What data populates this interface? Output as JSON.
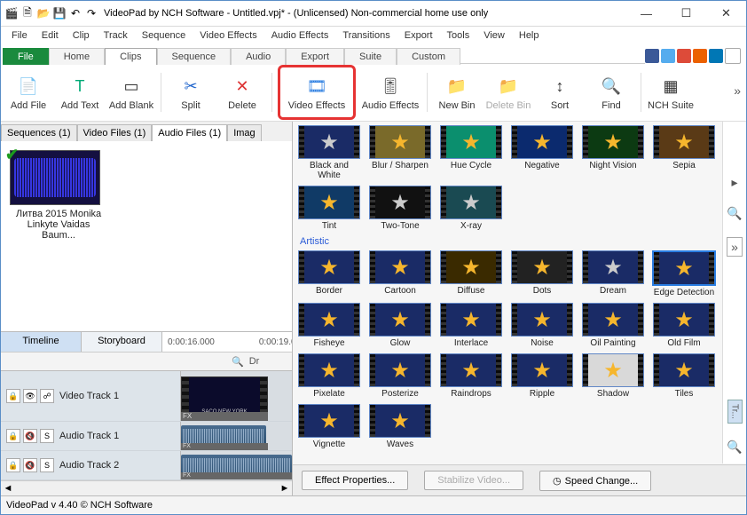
{
  "titlebar": {
    "title": "VideoPad by NCH Software - Untitled.vpj* - (Unlicensed) Non-commercial home use only"
  },
  "menubar": [
    "File",
    "Edit",
    "Clip",
    "Track",
    "Sequence",
    "Video Effects",
    "Audio Effects",
    "Transitions",
    "Export",
    "Tools",
    "View",
    "Help"
  ],
  "ribbon_tabs": [
    "File",
    "Home",
    "Clips",
    "Sequence",
    "Audio",
    "Export",
    "Suite",
    "Custom"
  ],
  "ribbon_active": "Clips",
  "toolbar": {
    "add_file": "Add File",
    "add_text": "Add Text",
    "add_blank": "Add Blank",
    "split": "Split",
    "delete": "Delete",
    "video_effects": "Video Effects",
    "audio_effects": "Audio Effects",
    "new_bin": "New Bin",
    "delete_bin": "Delete Bin",
    "sort": "Sort",
    "find": "Find",
    "nch_suite": "NCH Suite"
  },
  "file_tabs": [
    "Sequences (1)",
    "Video Files (1)",
    "Audio Files (1)",
    "Imag"
  ],
  "file_tabs_active": "Audio Files (1)",
  "clip": {
    "name": "Литва 2015 Monika Linkyte  Vaidas Baum..."
  },
  "timeline_tabs": {
    "timeline": "Timeline",
    "storyboard": "Storyboard"
  },
  "timecodes": [
    "0:00:16.000",
    "0:00:19.0"
  ],
  "tlopts": {
    "drop": "Dr"
  },
  "tracks": {
    "video1": "Video Track 1",
    "audio1": "Audio Track 1",
    "audio2": "Audio Track 2",
    "fx": "FX"
  },
  "fx": {
    "row1": [
      {
        "label": "Black and White",
        "cls": "graystar"
      },
      {
        "label": "Blur / Sharpen",
        "cls": "star",
        "bg": "#7a6a2a"
      },
      {
        "label": "Hue Cycle",
        "cls": "star",
        "bg": "#0b8f6e",
        "star": "#19e3b1"
      },
      {
        "label": "Negative",
        "cls": "star",
        "bg": "#0b2a6e",
        "star": "#1f62ff"
      },
      {
        "label": "Night Vision",
        "cls": "star",
        "bg": "#0c3a12",
        "star": "#68d66f"
      },
      {
        "label": "Sepia",
        "cls": "star",
        "bg": "#5a3a16",
        "star": "#c79a58"
      }
    ],
    "row2": [
      {
        "label": "Tint",
        "cls": "star",
        "bg": "#103a66",
        "star": "#63a6e8"
      },
      {
        "label": "Two-Tone",
        "cls": "graystar",
        "bg": "#111"
      },
      {
        "label": "X-ray",
        "cls": "graystar",
        "bg": "#1a4a52",
        "star": "#9fe"
      }
    ],
    "artistic_label": "Artistic",
    "artistic": [
      [
        {
          "label": "Border",
          "cls": "star"
        },
        {
          "label": "Cartoon",
          "cls": "star"
        },
        {
          "label": "Diffuse",
          "cls": "star",
          "bg": "#3a2a00"
        },
        {
          "label": "Dots",
          "cls": "star",
          "bg": "#222"
        },
        {
          "label": "Dream",
          "cls": "graystar"
        },
        {
          "label": "Edge Detection",
          "cls": "star",
          "sel": true
        }
      ],
      [
        {
          "label": "Fisheye",
          "cls": "star"
        },
        {
          "label": "Glow",
          "cls": "star"
        },
        {
          "label": "Interlace",
          "cls": "star"
        },
        {
          "label": "Noise",
          "cls": "star"
        },
        {
          "label": "Oil Painting",
          "cls": "star"
        },
        {
          "label": "Old Film",
          "cls": "star"
        }
      ],
      [
        {
          "label": "Pixelate",
          "cls": "star"
        },
        {
          "label": "Posterize",
          "cls": "star"
        },
        {
          "label": "Raindrops",
          "cls": "star"
        },
        {
          "label": "Ripple",
          "cls": "star"
        },
        {
          "label": "Shadow",
          "cls": "star",
          "bg": "#d9d9d9",
          "star": "#e0a62a"
        },
        {
          "label": "Tiles",
          "cls": "star"
        }
      ],
      [
        {
          "label": "Vignette",
          "cls": "star"
        },
        {
          "label": "Waves",
          "cls": "star"
        }
      ]
    ],
    "buttons": {
      "props": "Effect Properties...",
      "stab": "Stabilize Video...",
      "speed": "Speed Change..."
    }
  },
  "status": "VideoPad v 4.40 © NCH Software",
  "right_tabs": {
    "tr": "Tr..."
  }
}
